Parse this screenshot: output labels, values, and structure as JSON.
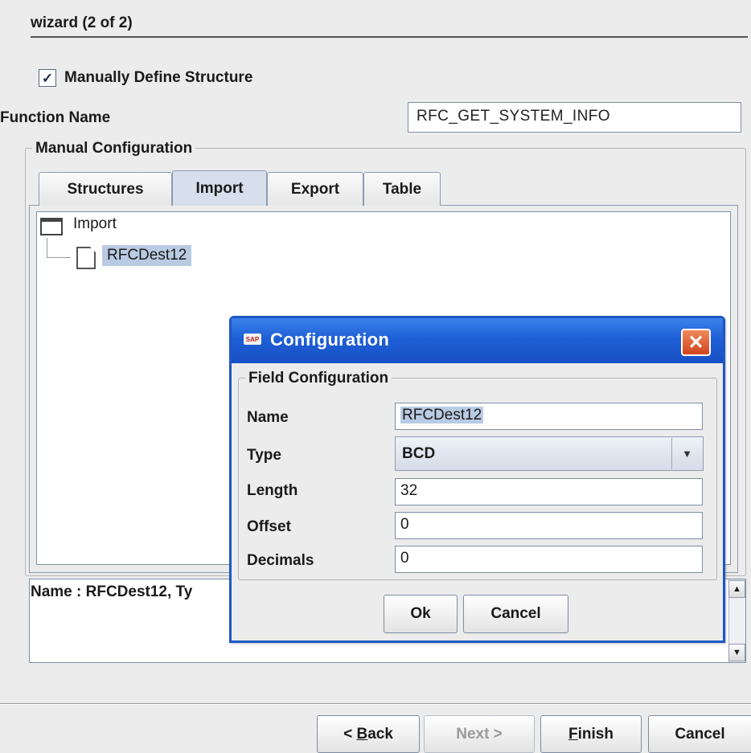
{
  "wizard": {
    "title": "wizard (2 of 2)",
    "manual_define_label": "Manually Define Structure",
    "manual_define_checked": true,
    "function_name_label": "Function Name",
    "function_name_value": "RFC_GET_SYSTEM_INFO",
    "manual_config_label": "Manual Configuration",
    "tabs": [
      {
        "label": "Structures",
        "active": false
      },
      {
        "label": "Import",
        "active": true
      },
      {
        "label": "Export",
        "active": false
      },
      {
        "label": "Table",
        "active": false
      }
    ],
    "tree": {
      "root": "Import",
      "child": "RFCDest12"
    },
    "status_text": "Name : RFCDest12, Ty",
    "buttons": {
      "back": {
        "prefix": "< ",
        "mnemonic": "B",
        "rest": "ack"
      },
      "next": "Next >",
      "finish": {
        "mnemonic": "F",
        "rest": "inish"
      },
      "cancel": "Cancel"
    }
  },
  "dialog": {
    "app_icon": "sap-icon",
    "title": "Configuration",
    "group_label": "Field Configuration",
    "fields": {
      "name": {
        "label": "Name",
        "value": "RFCDest12"
      },
      "type": {
        "label": "Type",
        "value": "BCD"
      },
      "length": {
        "label": "Length",
        "value": "32"
      },
      "offset": {
        "label": "Offset",
        "value": "0"
      },
      "decimals": {
        "label": "Decimals",
        "value": "0"
      }
    },
    "ok_label": "Ok",
    "cancel_label": "Cancel"
  },
  "colors": {
    "titlebar": "#1e5fd6",
    "close_button": "#d1451a",
    "selection": "#b9cbe3"
  }
}
